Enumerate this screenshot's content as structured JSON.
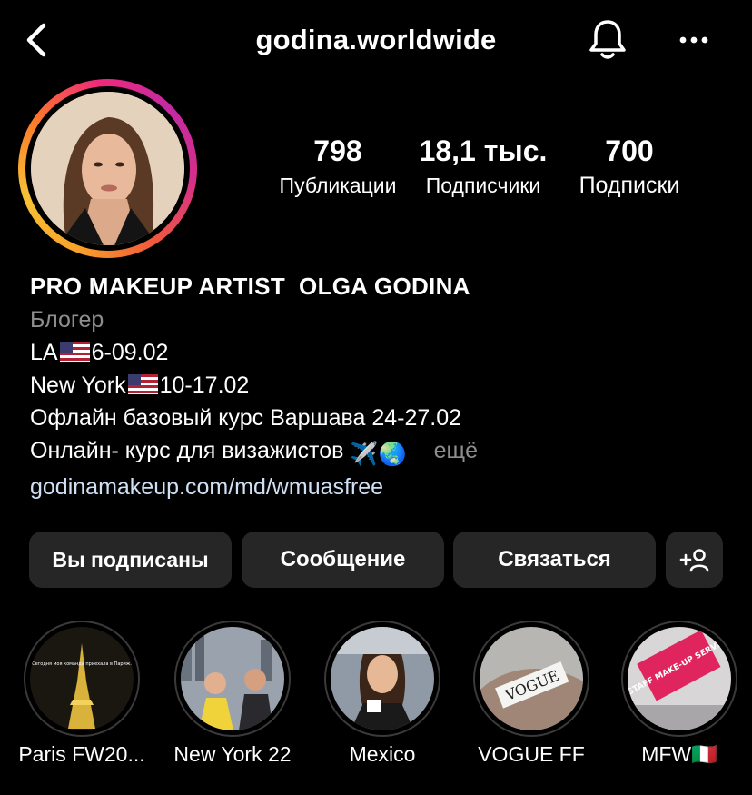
{
  "header": {
    "username": "godina.worldwide",
    "back_icon": "chevron-left-icon",
    "bell_icon": "bell-icon",
    "more_icon": "more-horizontal-icon"
  },
  "stats": {
    "posts": {
      "value": "798",
      "label": "Публикации"
    },
    "followers": {
      "value": "18,1 тыс.",
      "label": "Подписчики"
    },
    "following": {
      "value": "700",
      "label": "Подписки"
    }
  },
  "bio": {
    "name": "PRO MAKEUP ARTIST  OLGA GODINA",
    "category": "Блогер",
    "line_la_prefix": "LA",
    "line_la_dates": "6-09.02",
    "line_ny_prefix": "New York",
    "line_ny_dates": "10-17.02",
    "line_offline": "Офлайн базовый курс Варшава 24-27.02",
    "line_online": "Онлайн- курс для визажистов",
    "line_online_emoji": "✈️🌏",
    "more_label": "ещё",
    "link": "godinamakeup.com/md/wmuasfree"
  },
  "buttons": {
    "following": "Вы подписаны",
    "message": "Сообщение",
    "contact": "Связаться",
    "add_user_icon": "add-user-icon"
  },
  "highlights": [
    {
      "label": "Paris FW20...",
      "cover_text": "Сегодня моя команда приехала в Париж."
    },
    {
      "label": "New York 22"
    },
    {
      "label": "Mexico"
    },
    {
      "label": "VOGUE FF",
      "cover_text": "VOGUE"
    },
    {
      "label": "MFW🇮🇹",
      "cover_text": "STAFF MAKE-UP SERVICE"
    }
  ],
  "colors": {
    "background": "#000000",
    "button_bg": "#262626",
    "secondary_text": "#8e8e8e",
    "link_text": "#cfe0f5"
  }
}
